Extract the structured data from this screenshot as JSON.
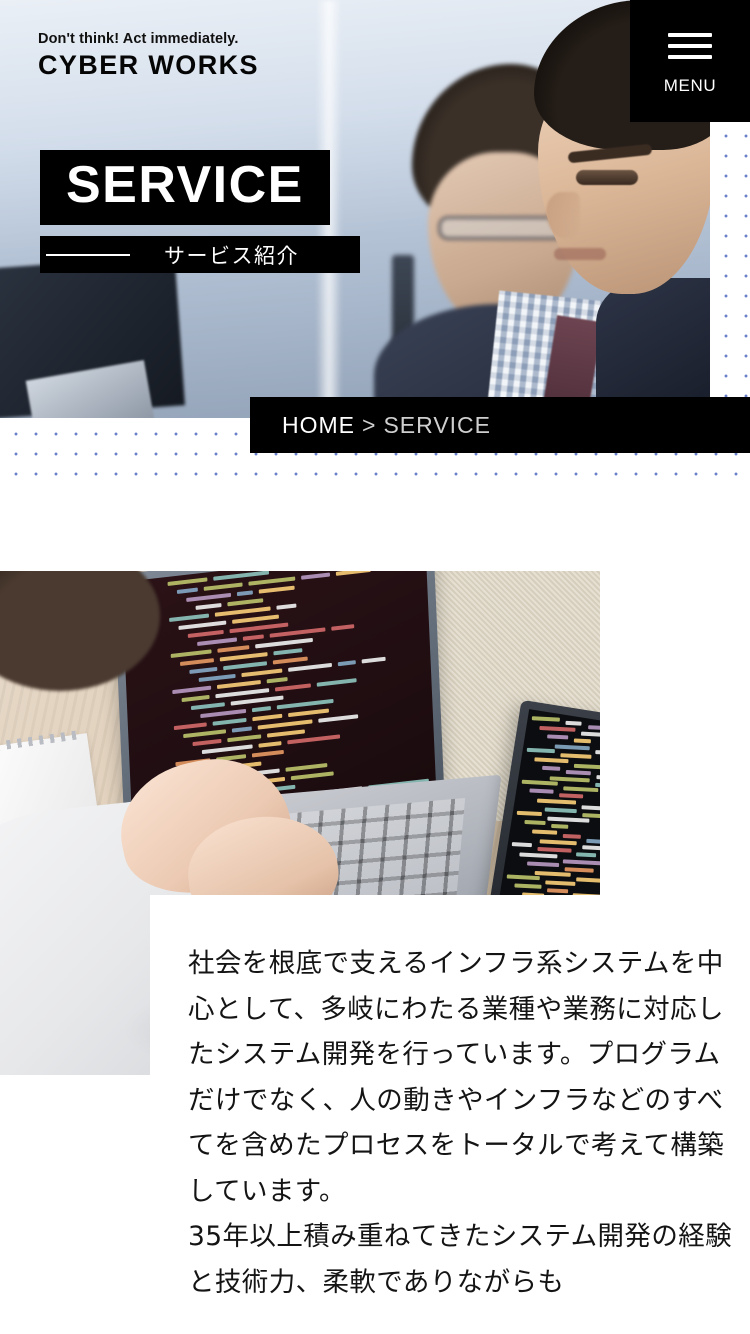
{
  "header": {
    "logo_tagline": "Don't think! Act immediately.",
    "logo_brand": "CYBER WORKS",
    "menu_label": "MENU",
    "menu_icon": "hamburger-icon"
  },
  "hero": {
    "title": "SERVICE",
    "subtitle": "サービス紹介",
    "photo_alt": "office-businessmen-photo"
  },
  "breadcrumb": {
    "home": "HOME",
    "separator": ">",
    "current": "SERVICE"
  },
  "main": {
    "photo_alt": "person-coding-on-laptop-photo",
    "description": "社会を根底で支えるインフラ系システムを中心として、多岐にわたる業種や業務に対応したシステム開発を行っています。プログラムだけでなく、人の動きやインフラなどのすべてを含めたプロセスをトータルで考えて構築しています。\n35年以上積み重ねてきたシステム開発の経験と技術力、柔軟でありながらも"
  },
  "colors": {
    "accent_black": "#000000",
    "text": "#141414",
    "dot_blue": "#6a80c8",
    "white": "#ffffff",
    "breadcrumb_inactive": "#cfcfcf"
  }
}
